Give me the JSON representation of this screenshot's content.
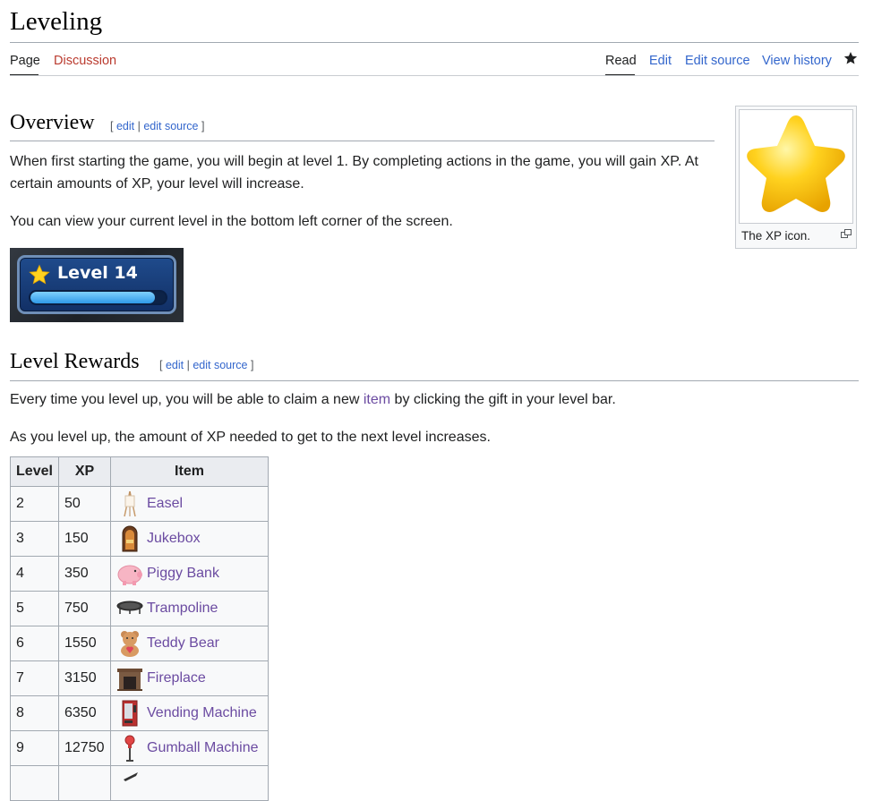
{
  "page": {
    "title": "Leveling"
  },
  "tabs": {
    "page": "Page",
    "discussion": "Discussion",
    "read": "Read",
    "edit": "Edit",
    "edit_source": "Edit source",
    "view_history": "View history"
  },
  "overview": {
    "heading": "Overview",
    "edit": "edit",
    "edit_source": "edit source",
    "para1": "When first starting the game, you will begin at level 1. By completing actions in the game, you will gain XP. At certain amounts of XP, your level will increase.",
    "para2": "You can view your current level in the bottom left corner of the screen.",
    "level_badge": {
      "text": "Level 14",
      "progress": 0.92
    }
  },
  "thumb": {
    "caption": "The XP icon."
  },
  "rewards": {
    "heading": "Level Rewards",
    "edit": "edit",
    "edit_source": "edit source",
    "para1_before": "Every time you level up, you will be able to claim a new ",
    "para1_link": "item",
    "para1_after": " by clicking the gift in your level bar.",
    "para2": "As you level up, the amount of XP needed to get to the next level increases."
  },
  "table": {
    "headers": [
      "Level",
      "XP",
      "Item"
    ],
    "rows": [
      {
        "level": "2",
        "xp": "50",
        "item": "Easel",
        "icon": "easel-icon"
      },
      {
        "level": "3",
        "xp": "150",
        "item": "Jukebox",
        "icon": "jukebox-icon"
      },
      {
        "level": "4",
        "xp": "350",
        "item": "Piggy Bank",
        "icon": "piggy-bank-icon"
      },
      {
        "level": "5",
        "xp": "750",
        "item": "Trampoline",
        "icon": "trampoline-icon"
      },
      {
        "level": "6",
        "xp": "1550",
        "item": "Teddy Bear",
        "icon": "teddy-bear-icon"
      },
      {
        "level": "7",
        "xp": "3150",
        "item": "Fireplace",
        "icon": "fireplace-icon"
      },
      {
        "level": "8",
        "xp": "6350",
        "item": "Vending Machine",
        "icon": "vending-machine-icon"
      },
      {
        "level": "9",
        "xp": "12750",
        "item": "Gumball Machine",
        "icon": "gumball-machine-icon"
      },
      {
        "level": "",
        "xp": "",
        "item": "",
        "icon": ""
      }
    ]
  }
}
